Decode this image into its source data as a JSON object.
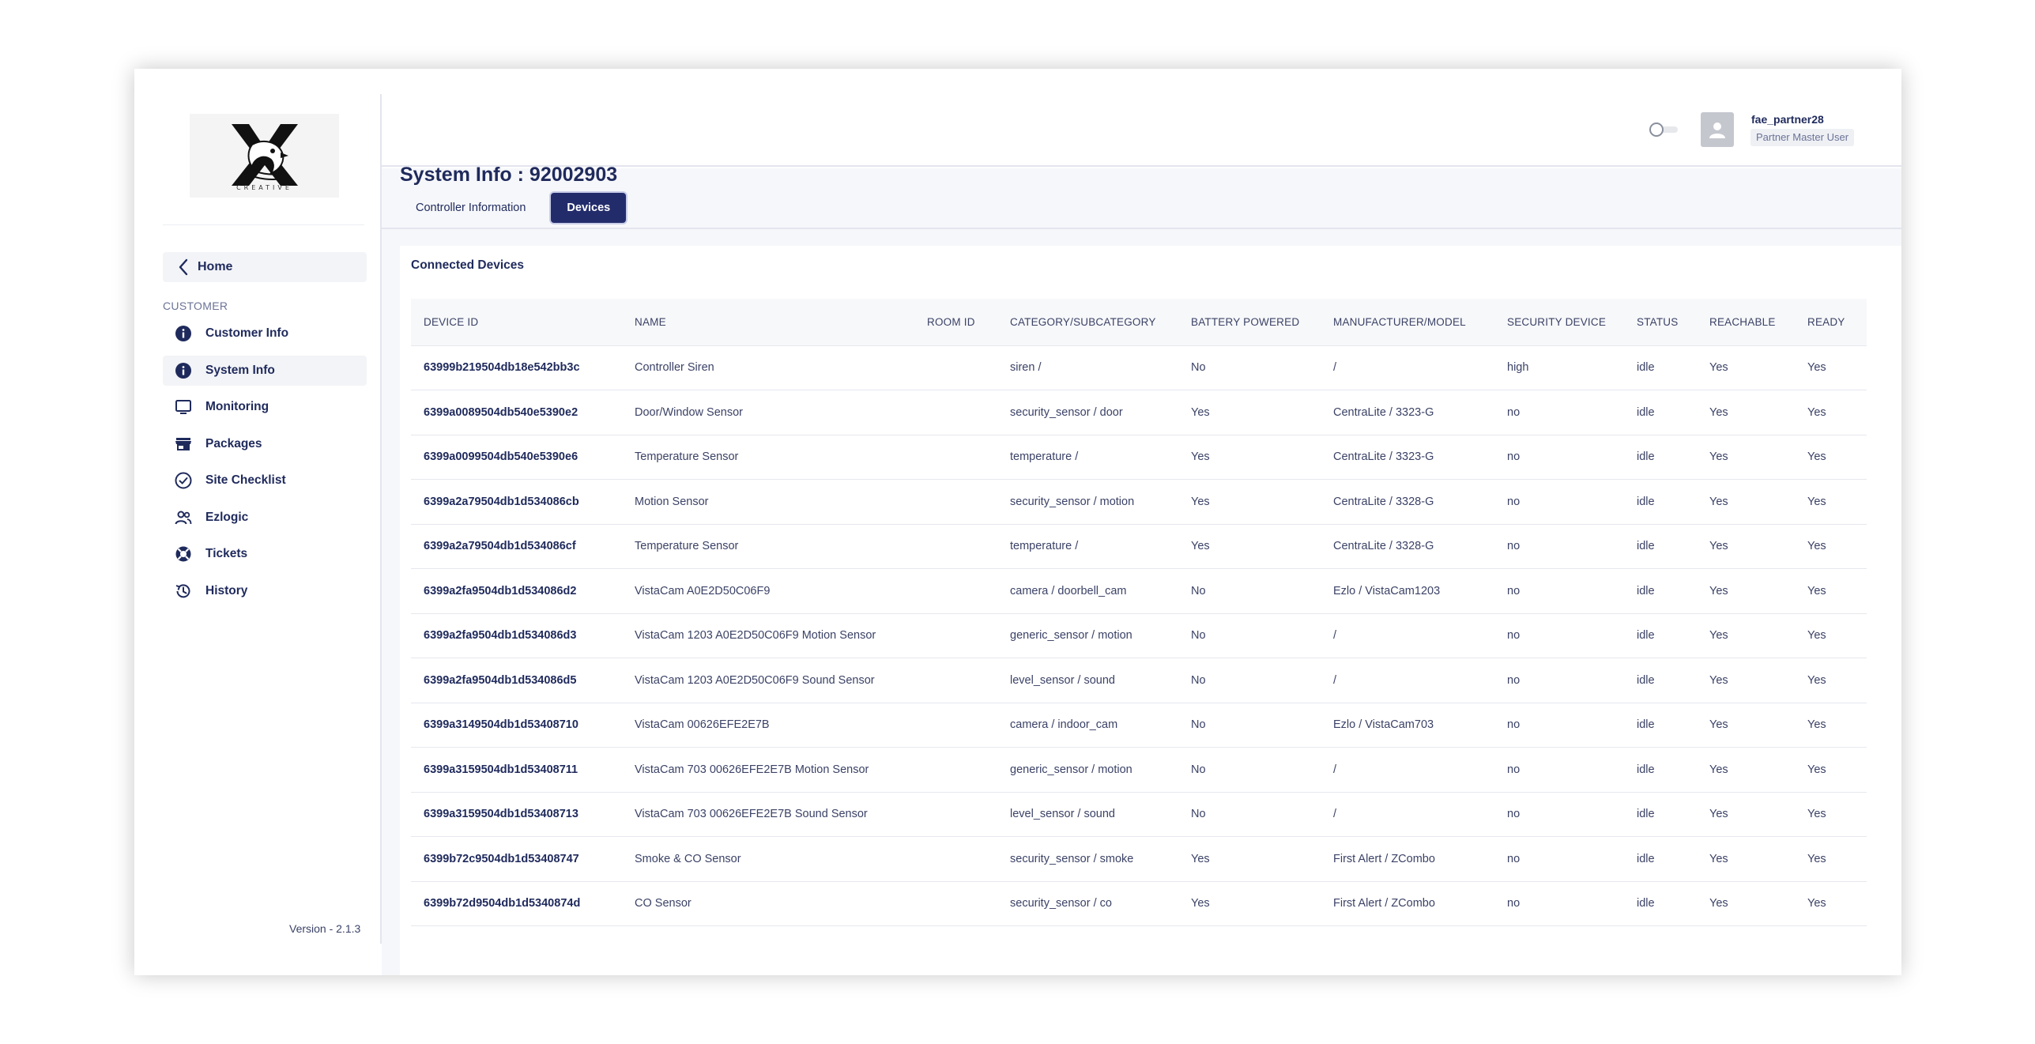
{
  "sidebar": {
    "logo_word": "CREATIVE",
    "home_label": "Home",
    "section_label": "CUSTOMER",
    "items": [
      {
        "label": "Customer Info",
        "icon": "info-icon",
        "active": false
      },
      {
        "label": "System Info",
        "icon": "info-icon",
        "active": true
      },
      {
        "label": "Monitoring",
        "icon": "monitor-icon",
        "active": false
      },
      {
        "label": "Packages",
        "icon": "store-icon",
        "active": false
      },
      {
        "label": "Site Checklist",
        "icon": "check-circle-icon",
        "active": false
      },
      {
        "label": "Ezlogic",
        "icon": "users-icon",
        "active": false
      },
      {
        "label": "Tickets",
        "icon": "lifebuoy-icon",
        "active": false
      },
      {
        "label": "History",
        "icon": "history-icon",
        "active": false
      }
    ],
    "version": "Version - 2.1.3"
  },
  "header": {
    "user_name": "fae_partner28",
    "user_role": "Partner Master User"
  },
  "main": {
    "title": "System Info : 92002903",
    "tabs": [
      {
        "label": "Controller Information",
        "active": false
      },
      {
        "label": "Devices",
        "active": true
      }
    ],
    "card_title": "Connected Devices",
    "columns": [
      "DEVICE ID",
      "NAME",
      "ROOM ID",
      "CATEGORY/SUBCATEGORY",
      "BATTERY POWERED",
      "MANUFACTURER/MODEL",
      "SECURITY DEVICE",
      "STATUS",
      "REACHABLE",
      "READY"
    ],
    "rows": [
      [
        "63999b219504db18e542bb3c",
        "Controller Siren",
        "",
        "siren /",
        "No",
        "/",
        "high",
        "idle",
        "Yes",
        "Yes"
      ],
      [
        "6399a0089504db540e5390e2",
        "Door/Window Sensor",
        "",
        "security_sensor / door",
        "Yes",
        "CentraLite / 3323-G",
        "no",
        "idle",
        "Yes",
        "Yes"
      ],
      [
        "6399a0099504db540e5390e6",
        "Temperature Sensor",
        "",
        "temperature /",
        "Yes",
        "CentraLite / 3323-G",
        "no",
        "idle",
        "Yes",
        "Yes"
      ],
      [
        "6399a2a79504db1d534086cb",
        "Motion Sensor",
        "",
        "security_sensor / motion",
        "Yes",
        "CentraLite / 3328-G",
        "no",
        "idle",
        "Yes",
        "Yes"
      ],
      [
        "6399a2a79504db1d534086cf",
        "Temperature Sensor",
        "",
        "temperature /",
        "Yes",
        "CentraLite / 3328-G",
        "no",
        "idle",
        "Yes",
        "Yes"
      ],
      [
        "6399a2fa9504db1d534086d2",
        "VistaCam A0E2D50C06F9",
        "",
        "camera / doorbell_cam",
        "No",
        "Ezlo / VistaCam1203",
        "no",
        "idle",
        "Yes",
        "Yes"
      ],
      [
        "6399a2fa9504db1d534086d3",
        "VistaCam 1203 A0E2D50C06F9 Motion Sensor",
        "",
        "generic_sensor / motion",
        "No",
        "/",
        "no",
        "idle",
        "Yes",
        "Yes"
      ],
      [
        "6399a2fa9504db1d534086d5",
        "VistaCam 1203 A0E2D50C06F9 Sound Sensor",
        "",
        "level_sensor / sound",
        "No",
        "/",
        "no",
        "idle",
        "Yes",
        "Yes"
      ],
      [
        "6399a3149504db1d53408710",
        "VistaCam 00626EFE2E7B",
        "",
        "camera / indoor_cam",
        "No",
        "Ezlo / VistaCam703",
        "no",
        "idle",
        "Yes",
        "Yes"
      ],
      [
        "6399a3159504db1d53408711",
        "VistaCam 703 00626EFE2E7B Motion Sensor",
        "",
        "generic_sensor / motion",
        "No",
        "/",
        "no",
        "idle",
        "Yes",
        "Yes"
      ],
      [
        "6399a3159504db1d53408713",
        "VistaCam 703 00626EFE2E7B Sound Sensor",
        "",
        "level_sensor / sound",
        "No",
        "/",
        "no",
        "idle",
        "Yes",
        "Yes"
      ],
      [
        "6399b72c9504db1d53408747",
        "Smoke & CO Sensor",
        "",
        "security_sensor / smoke",
        "Yes",
        "First Alert / ZCombo",
        "no",
        "idle",
        "Yes",
        "Yes"
      ],
      [
        "6399b72d9504db1d5340874d",
        "CO Sensor",
        "",
        "security_sensor / co",
        "Yes",
        "First Alert / ZCombo",
        "no",
        "idle",
        "Yes",
        "Yes"
      ]
    ]
  },
  "colors": {
    "primary": "#232c6b",
    "text": "#1f2a5c",
    "muted": "#6b7397",
    "content_bg": "#f6f7fa"
  }
}
